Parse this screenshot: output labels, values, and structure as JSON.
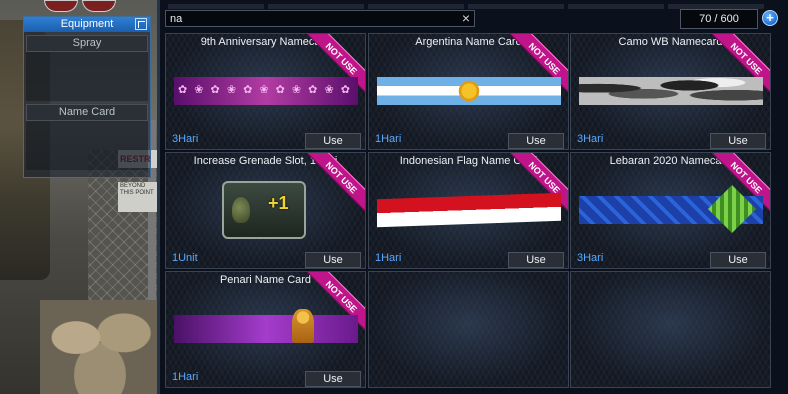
{
  "equipment": {
    "title": "Equipment",
    "slots": [
      {
        "label": "Spray"
      },
      {
        "label": "Name Card"
      }
    ]
  },
  "inventory": {
    "search": {
      "value": "na",
      "placeholder": ""
    },
    "counter": "70 / 600",
    "add_label": "+",
    "clear_label": "×",
    "items": [
      {
        "name": "9th Anniversary Namecard",
        "ribbon": "NOT USE",
        "duration": "3Hari",
        "use_label": "Use",
        "art": "anniversary-banner"
      },
      {
        "name": "Argentina Name Card",
        "ribbon": "NOT USE",
        "duration": "1Hari",
        "use_label": "Use",
        "art": "argentina-flag-banner"
      },
      {
        "name": "Camo WB Namecard",
        "ribbon": "NOT USE",
        "duration": "3Hari",
        "use_label": "Use",
        "art": "camo-banner"
      },
      {
        "name": "Increase Grenade Slot, 1 hari",
        "ribbon": "NOT USE",
        "duration": "1Unit",
        "use_label": "Use",
        "art": "grenade-slot-icon"
      },
      {
        "name": "Indonesian Flag Name Card",
        "ribbon": "NOT USE",
        "duration": "1Hari",
        "use_label": "Use",
        "art": "indonesia-flag-banner"
      },
      {
        "name": "Lebaran 2020 Namecard",
        "ribbon": "NOT USE",
        "duration": "3Hari",
        "use_label": "Use",
        "art": "lebaran-banner"
      },
      {
        "name": "Penari Name Card",
        "ribbon": "NOT USE",
        "duration": "1Hari",
        "use_label": "Use",
        "art": "penari-banner"
      }
    ]
  },
  "scene": {
    "sign_text": "RESTR",
    "sign2_text": "BEYOND THIS POINT"
  }
}
